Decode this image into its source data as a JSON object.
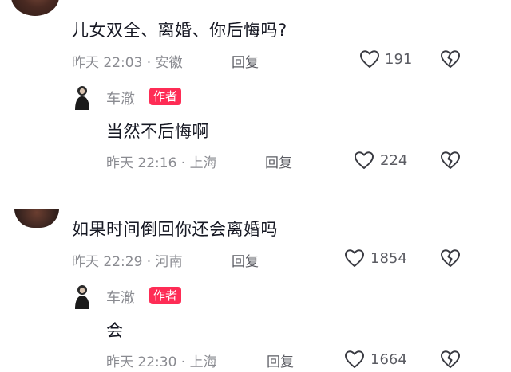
{
  "comments": [
    {
      "text": "儿女双全、离婚、你后悔吗?",
      "time": "昨天 22:03",
      "location": "安徽",
      "reply_label": "回复",
      "likes": "191",
      "author_reply": {
        "name": "车澈",
        "badge": "作者",
        "text": "当然不后悔啊",
        "time": "昨天 22:16",
        "location": "上海",
        "reply_label": "回复",
        "likes": "224"
      }
    },
    {
      "text": "如果时间倒回你还会离婚吗",
      "time": "昨天 22:29",
      "location": "河南",
      "reply_label": "回复",
      "likes": "1854",
      "author_reply": {
        "name": "车澈",
        "badge": "作者",
        "text": "会",
        "time": "昨天 22:30",
        "location": "上海",
        "reply_label": "回复",
        "likes": "1664"
      }
    }
  ],
  "icons": {
    "like": "heart-outline-icon",
    "dislike": "broken-heart-icon"
  },
  "colors": {
    "badge": "#fe2c55",
    "meta": "#8a8b91",
    "text": "#161823"
  }
}
